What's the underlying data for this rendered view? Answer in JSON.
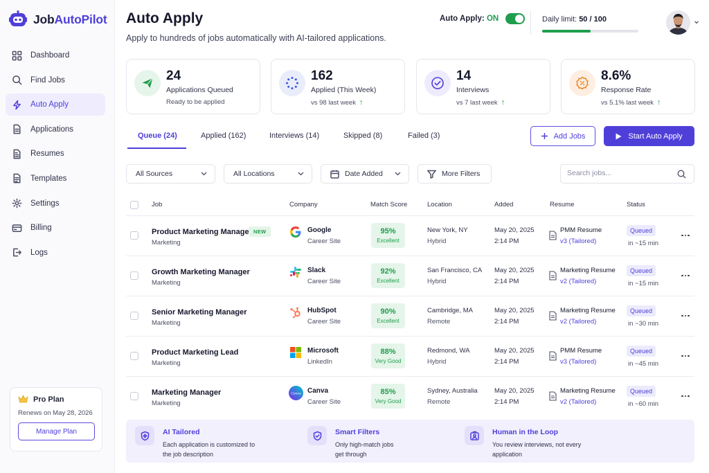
{
  "brand": {
    "name_part1": "Job",
    "name_part2": "AutoPilot"
  },
  "sidebar": {
    "items": [
      {
        "label": "Dashboard",
        "icon": "grid-icon"
      },
      {
        "label": "Find Jobs",
        "icon": "search-icon"
      },
      {
        "label": "Auto Apply",
        "icon": "lightning-icon",
        "active": true
      },
      {
        "label": "Applications",
        "icon": "document-icon"
      },
      {
        "label": "Resumes",
        "icon": "file-icon"
      },
      {
        "label": "Templates",
        "icon": "template-icon"
      },
      {
        "label": "Settings",
        "icon": "gear-icon"
      },
      {
        "label": "Billing",
        "icon": "card-icon"
      },
      {
        "label": "Logs",
        "icon": "logout-icon"
      }
    ],
    "plan": {
      "title": "Pro Plan",
      "renews": "Renews on May 28, 2026",
      "button": "Manage Plan"
    }
  },
  "header": {
    "title": "Auto Apply",
    "subtitle": "Apply to hundreds of jobs automatically with AI-tailored applications.",
    "auto_apply_label": "Auto Apply:",
    "auto_apply_state": "ON",
    "limit_label": "Daily limit:",
    "limit_value": "50 / 100",
    "limit_fraction": 0.5
  },
  "stats": [
    {
      "value": "24",
      "label": "Applications Queued",
      "sub": "Ready to be applied",
      "trend": false
    },
    {
      "value": "162",
      "label": "Applied (This Week)",
      "sub": "vs 98 last week",
      "trend": true
    },
    {
      "value": "14",
      "label": "Interviews",
      "sub": "vs 7 last week",
      "trend": true
    },
    {
      "value": "8.6%",
      "label": "Response Rate",
      "sub": "vs 5.1% last week",
      "trend": true
    }
  ],
  "tabs": [
    {
      "label": "Queue (24)",
      "active": true
    },
    {
      "label": "Applied (162)"
    },
    {
      "label": "Interviews (14)"
    },
    {
      "label": "Skipped (8)"
    },
    {
      "label": "Failed (3)"
    }
  ],
  "actions": {
    "add_jobs": "Add Jobs",
    "start": "Start Auto Apply"
  },
  "filters": {
    "sources": "All Sources",
    "locations": "All Locations",
    "date": "Date Added",
    "more": "More Filters",
    "search_placeholder": "Search jobs..."
  },
  "table": {
    "columns": [
      "Job",
      "Company",
      "Match Score",
      "Location",
      "Added",
      "Resume",
      "Status"
    ],
    "rows": [
      {
        "job": "Product Marketing Manager",
        "category": "Marketing",
        "badge": "NEW",
        "company": "Google",
        "source": "Career Site",
        "logo": "google-logo",
        "score": "95%",
        "score_label": "Excellent",
        "city": "New York, NY",
        "mode": "Hybrid",
        "date": "May 20, 2025",
        "time": "2:14 PM",
        "resume": "PMM Resume",
        "version": "v3 (Tailored)",
        "status": "Queued",
        "eta": "in ~15 min"
      },
      {
        "job": "Growth Marketing Manager",
        "category": "Marketing",
        "badge": "",
        "company": "Slack",
        "source": "Career Site",
        "logo": "slack-logo",
        "score": "92%",
        "score_label": "Excellent",
        "city": "San Francisco, CA",
        "mode": "Hybrid",
        "date": "May 20, 2025",
        "time": "2:14 PM",
        "resume": "Marketing Resume",
        "version": "v2 (Tailored)",
        "status": "Queued",
        "eta": "in ~15 min"
      },
      {
        "job": "Senior Marketing Manager",
        "category": "Marketing",
        "badge": "",
        "company": "HubSpot",
        "source": "Career Site",
        "logo": "hubspot-logo",
        "score": "90%",
        "score_label": "Excellent",
        "city": "Cambridge, MA",
        "mode": "Remote",
        "date": "May 20, 2025",
        "time": "2:14 PM",
        "resume": "Marketing Resume",
        "version": "v2 (Tailored)",
        "status": "Queued",
        "eta": "in ~30 min"
      },
      {
        "job": "Product Marketing Lead",
        "category": "Marketing",
        "badge": "",
        "company": "Microsoft",
        "source": "LinkedIn",
        "logo": "microsoft-logo",
        "score": "88%",
        "score_label": "Very Good",
        "city": "Redmond, WA",
        "mode": "Hybrid",
        "date": "May 20, 2025",
        "time": "2:14 PM",
        "resume": "PMM Resume",
        "version": "v3 (Tailored)",
        "status": "Queued",
        "eta": "in ~45 min"
      },
      {
        "job": "Marketing Manager",
        "category": "Marketing",
        "badge": "",
        "company": "Canva",
        "source": "Career Site",
        "logo": "canva-logo",
        "score": "85%",
        "score_label": "Very Good",
        "city": "Sydney, Australia",
        "mode": "Remote",
        "date": "May 20, 2025",
        "time": "2:14 PM",
        "resume": "Marketing Resume",
        "version": "v2 (Tailored)",
        "status": "Queued",
        "eta": "in ~60 min"
      }
    ]
  },
  "features": [
    {
      "title": "AI Tailored",
      "desc": "Each application is customized to the job description",
      "icon": "sparkle-shield-icon"
    },
    {
      "title": "Smart Filters",
      "desc": "Only high-match jobs get through",
      "icon": "shield-check-icon"
    },
    {
      "title": "Human in the Loop",
      "desc": "You review interviews, not every application",
      "icon": "user-check-icon"
    }
  ],
  "colors": {
    "accent": "#4f3fd9",
    "success": "#1f9d4c",
    "queued_bg": "#ecebfd"
  }
}
